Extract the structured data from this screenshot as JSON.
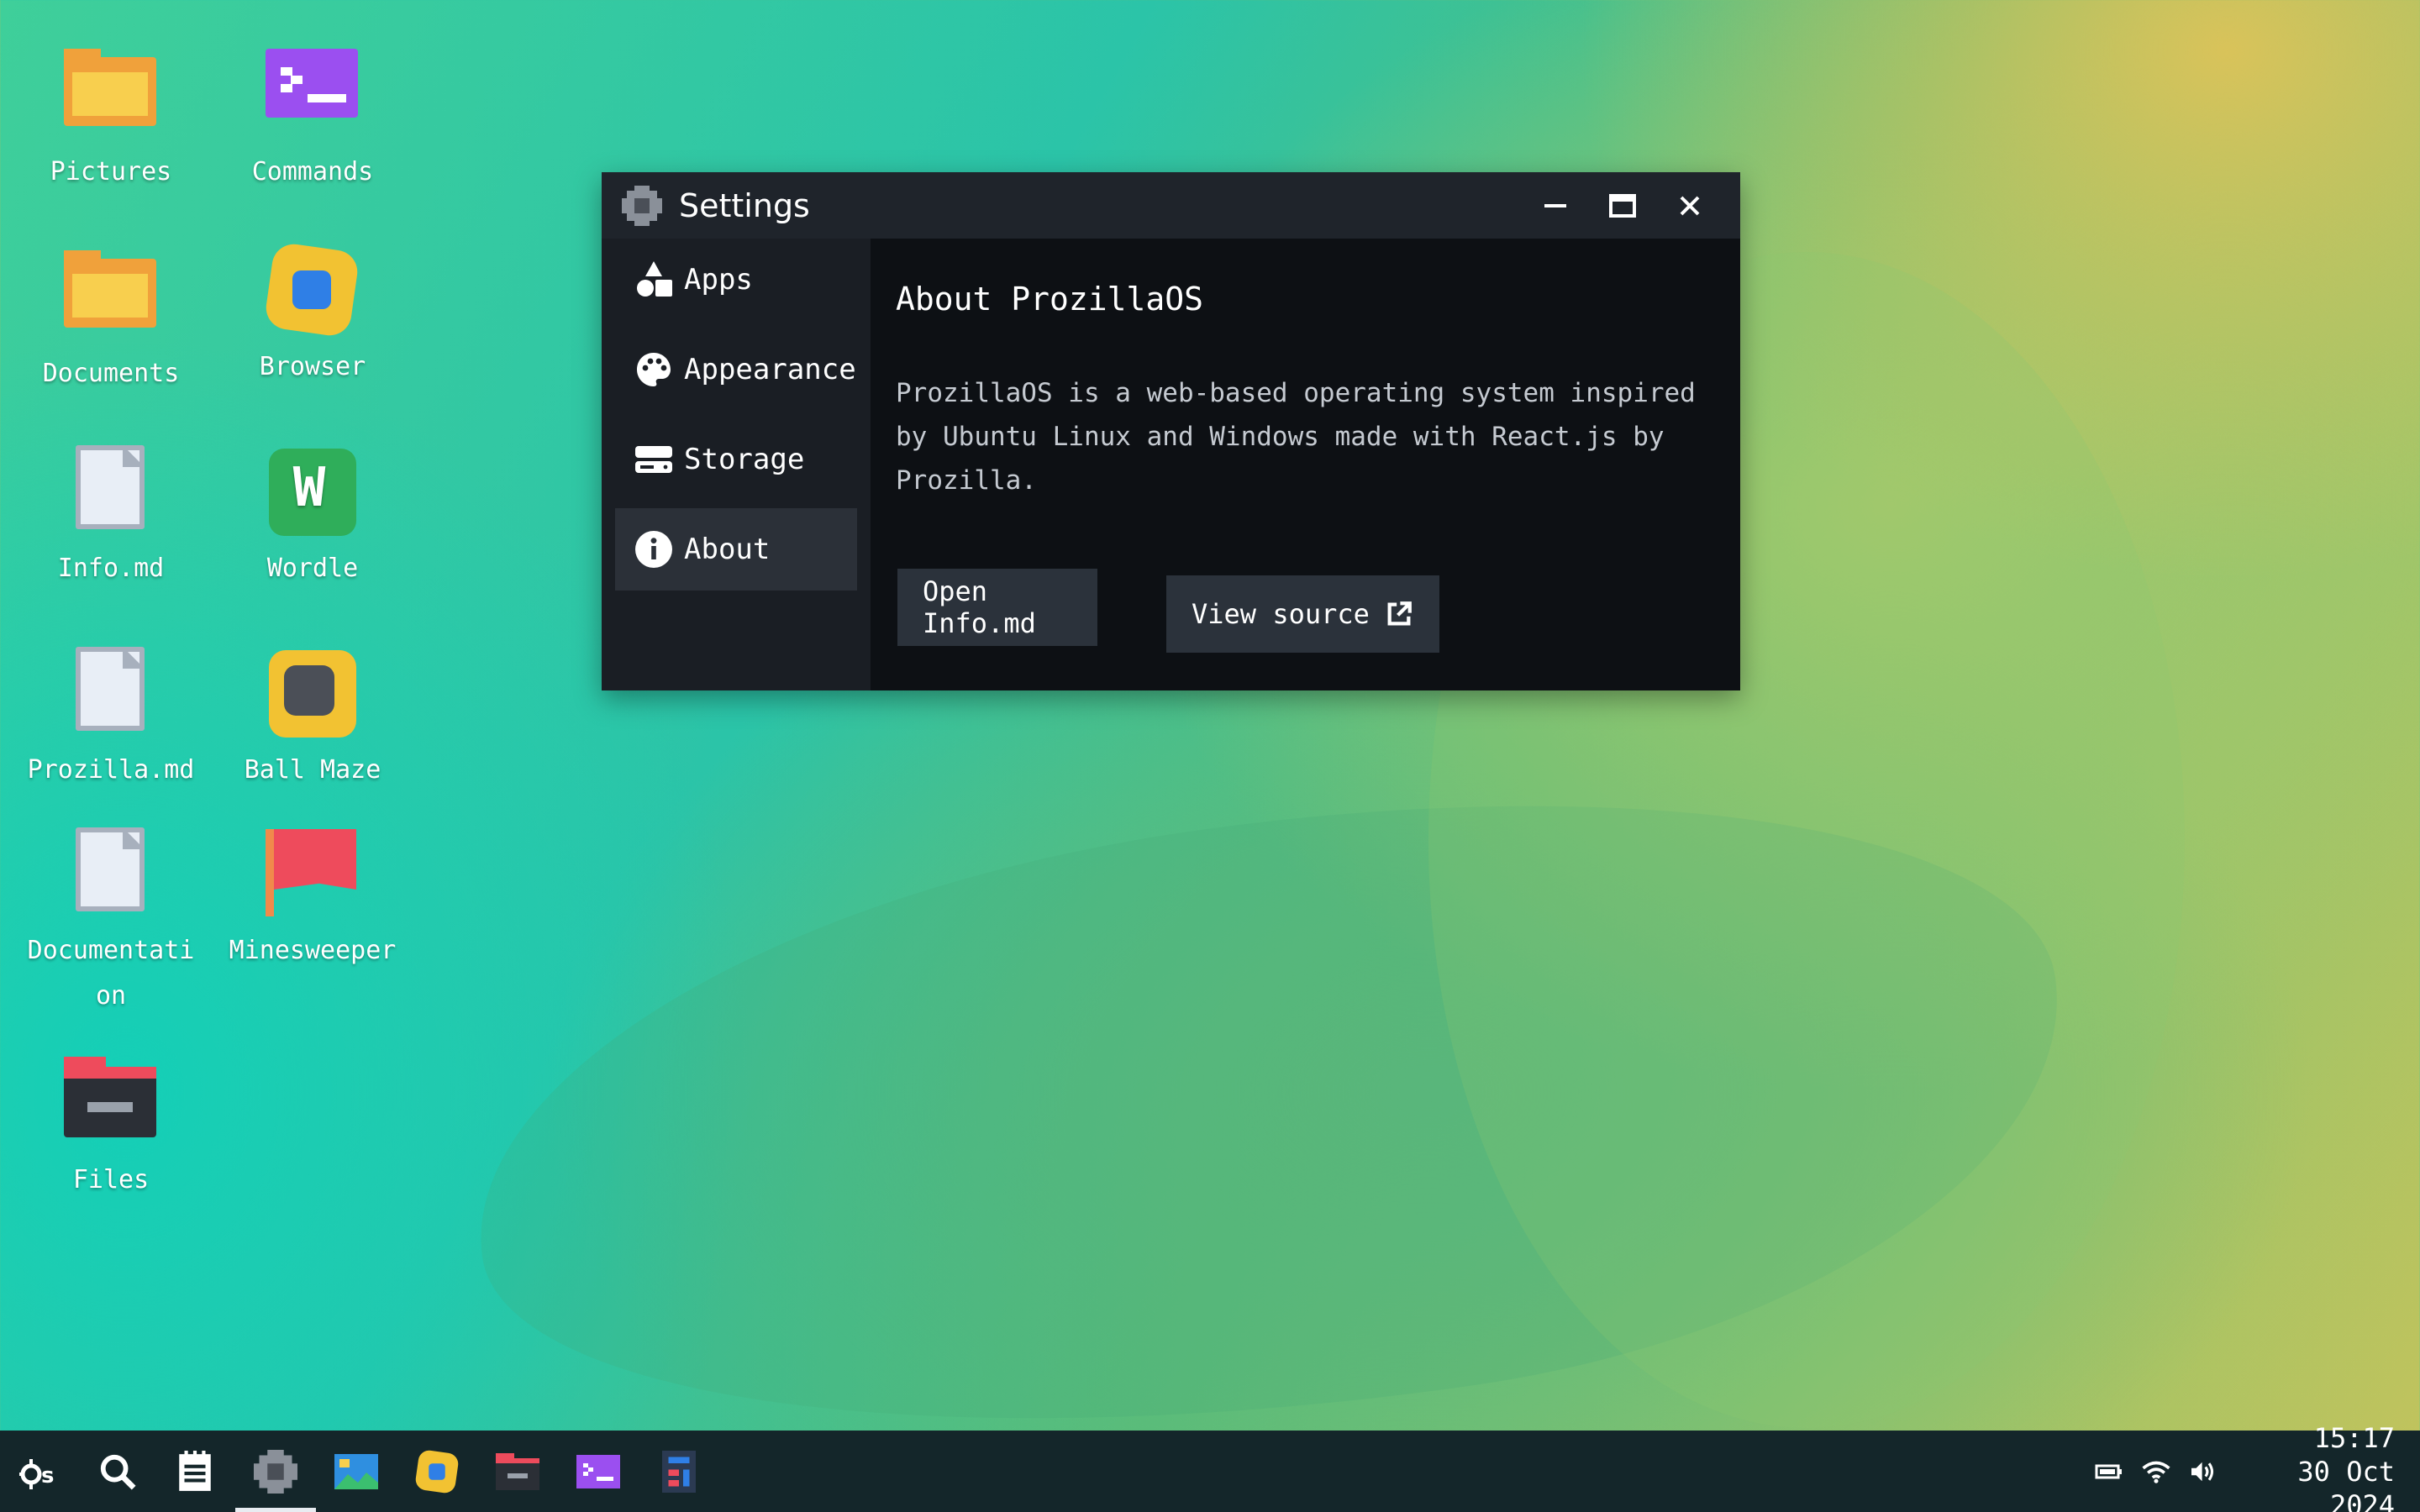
{
  "desktop": {
    "icons": [
      {
        "label": "Pictures",
        "icon": "folder-icon"
      },
      {
        "label": "Commands",
        "icon": "terminal-icon"
      },
      {
        "label": "Documents",
        "icon": "folder-icon"
      },
      {
        "label": "Browser",
        "icon": "browser-icon"
      },
      {
        "label": "Info.md",
        "icon": "document-icon"
      },
      {
        "label": "Wordle",
        "icon": "wordle-icon"
      },
      {
        "label": "Prozilla.md",
        "icon": "document-icon"
      },
      {
        "label": "Ball Maze",
        "icon": "ball-maze-icon"
      },
      {
        "label": "Documentation",
        "icon": "document-icon"
      },
      {
        "label": "Minesweeper",
        "icon": "flag-icon"
      },
      {
        "label": "Files",
        "icon": "file-manager-icon"
      }
    ]
  },
  "window": {
    "title": "Settings",
    "controls": {
      "minimize": "minimize-icon",
      "maximize": "maximize-icon",
      "close": "close-icon"
    },
    "sidebar": {
      "items": [
        {
          "label": "Apps",
          "icon": "shapes-icon"
        },
        {
          "label": "Appearance",
          "icon": "palette-icon"
        },
        {
          "label": "Storage",
          "icon": "hard-drive-icon"
        },
        {
          "label": "About",
          "icon": "info-icon",
          "active": true
        }
      ]
    },
    "about": {
      "title": "About ProzillaOS",
      "description": "ProzillaOS is a web-based operating system inspired by Ubuntu Linux and Windows made with React.js by Prozilla.",
      "open_button": "Open Info.md",
      "view_source_button": "View source"
    }
  },
  "taskbar": {
    "apps": [
      {
        "name": "home",
        "icon": "os-logo-icon"
      },
      {
        "name": "search",
        "icon": "search-icon"
      },
      {
        "name": "text-editor",
        "icon": "notepad-icon"
      },
      {
        "name": "settings",
        "icon": "settings-icon",
        "active": true
      },
      {
        "name": "media-viewer",
        "icon": "image-icon"
      },
      {
        "name": "browser",
        "icon": "browser-icon"
      },
      {
        "name": "file-explorer",
        "icon": "file-manager-icon"
      },
      {
        "name": "terminal",
        "icon": "terminal-icon"
      },
      {
        "name": "logic-sim",
        "icon": "logic-icon"
      }
    ],
    "tray": {
      "battery": "battery-icon",
      "wifi": "wifi-icon",
      "volume": "volume-icon"
    },
    "clock": {
      "time": "15:17",
      "date": "30 Oct 2024"
    }
  },
  "colors": {
    "accent": "#f0a13b",
    "window_bg": "#0d1014",
    "titlebar": "#1f242b",
    "sidebar": "#1a1e24",
    "taskbar": "#14262a"
  }
}
